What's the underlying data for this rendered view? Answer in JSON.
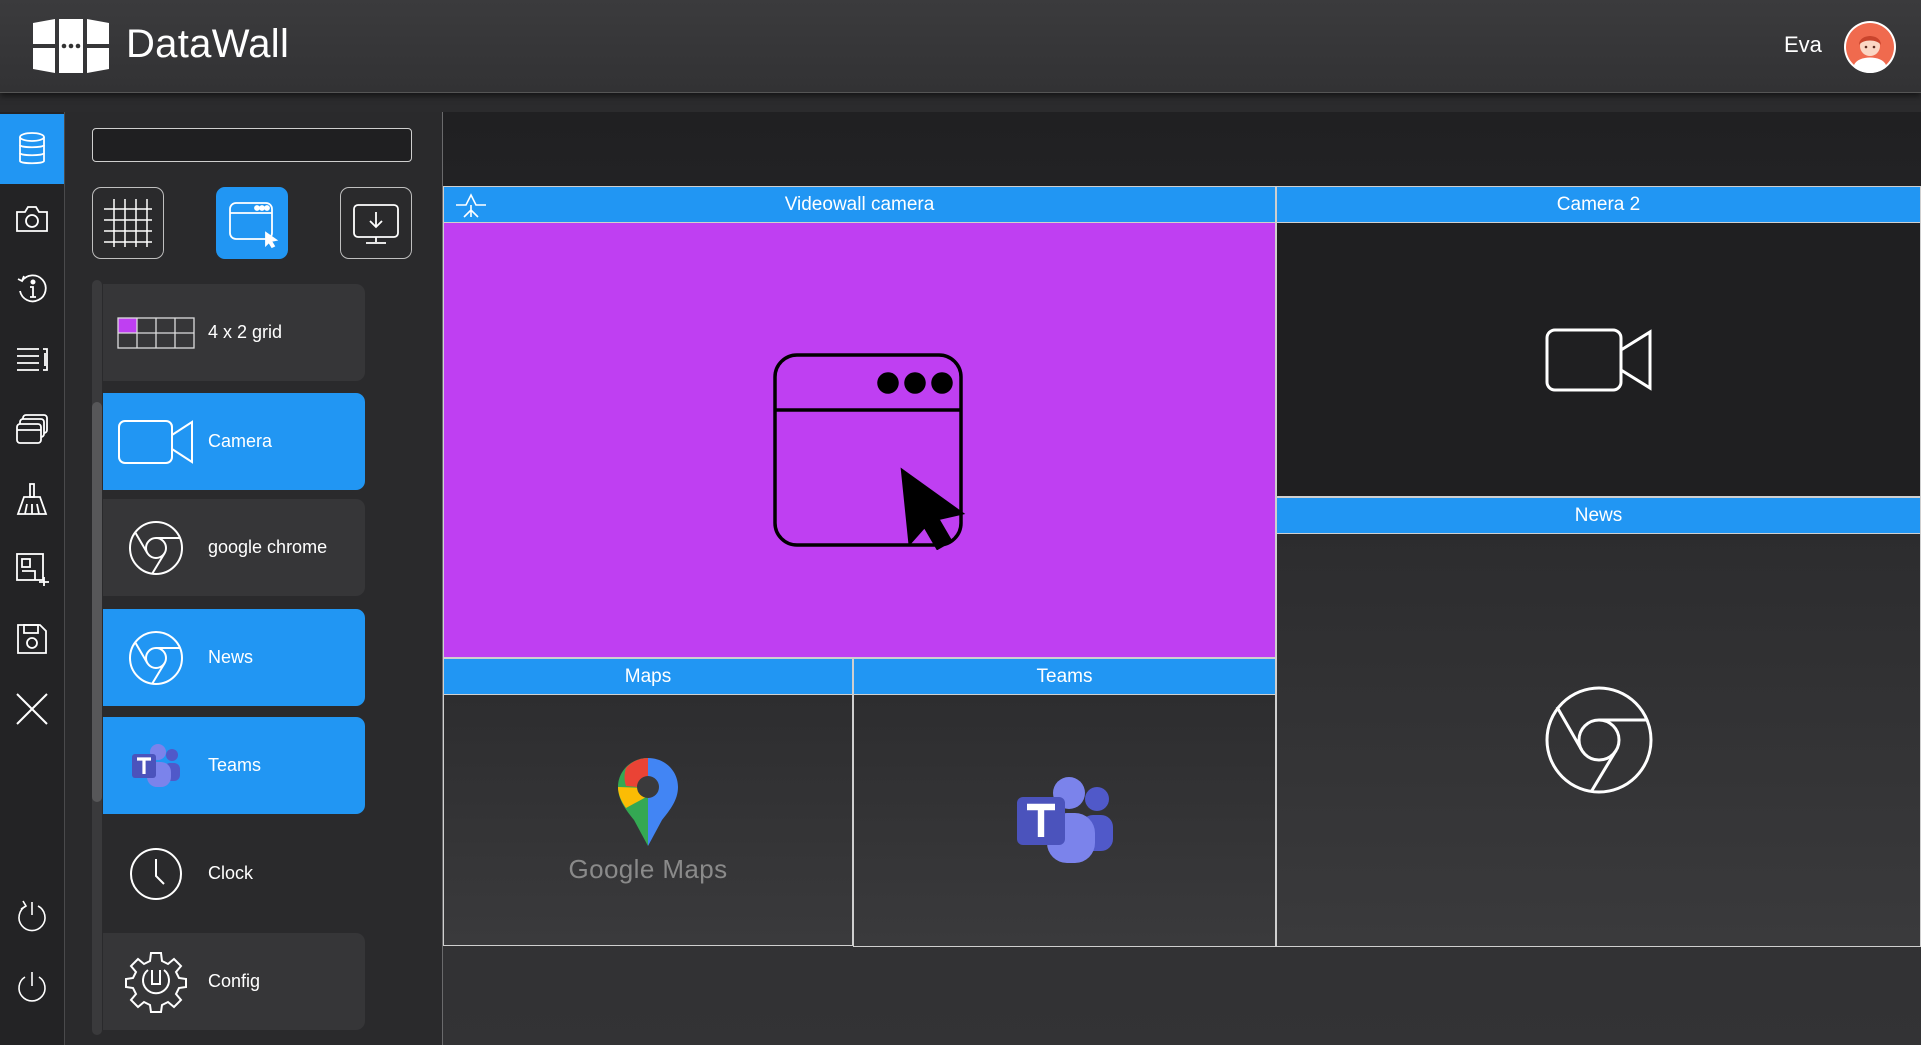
{
  "app": {
    "title": "DataWall"
  },
  "user": {
    "name": "Eva"
  },
  "rail": {
    "items": [
      {
        "icon": "database-icon",
        "active": true
      },
      {
        "icon": "camera-icon"
      },
      {
        "icon": "info-icon"
      },
      {
        "icon": "list-icon"
      },
      {
        "icon": "windows-stack-icon"
      },
      {
        "icon": "broom-icon"
      },
      {
        "icon": "layout-icon"
      },
      {
        "icon": "save-icon"
      },
      {
        "icon": "close-icon"
      },
      {
        "icon": "restart-icon"
      },
      {
        "icon": "power-icon"
      }
    ]
  },
  "library": {
    "search": {
      "value": "",
      "placeholder": ""
    },
    "modes": [
      {
        "icon": "grid-icon"
      },
      {
        "icon": "window-cursor-icon",
        "active": true
      },
      {
        "icon": "monitor-download-icon"
      }
    ],
    "items": [
      {
        "label": "4 x 2 grid",
        "icon": "grid-layout-icon",
        "style": "dark"
      },
      {
        "label": "Camera",
        "icon": "video-camera-icon",
        "style": "blue"
      },
      {
        "label": "google chrome",
        "icon": "chrome-icon",
        "style": "dark"
      },
      {
        "label": "News",
        "icon": "chrome-icon",
        "style": "blue"
      },
      {
        "label": "Teams",
        "icon": "teams-icon",
        "style": "blue"
      },
      {
        "label": "Clock",
        "icon": "clock-icon",
        "style": "plain"
      },
      {
        "label": "Config",
        "icon": "gear-icon",
        "style": "dark"
      }
    ]
  },
  "wall": {
    "tiles": [
      {
        "title": "Videowall camera",
        "icon": "window-cursor-icon",
        "selected": true
      },
      {
        "title": "Camera 2",
        "icon": "video-camera-icon"
      },
      {
        "title": "News",
        "icon": "chrome-icon"
      },
      {
        "title": "Maps",
        "icon": "google-maps-icon",
        "caption": "Google Maps"
      },
      {
        "title": "Teams",
        "icon": "teams-icon"
      }
    ]
  },
  "colors": {
    "accent": "#2196f3",
    "selected": "#bf3ff2",
    "background": "#2b2b2d"
  }
}
